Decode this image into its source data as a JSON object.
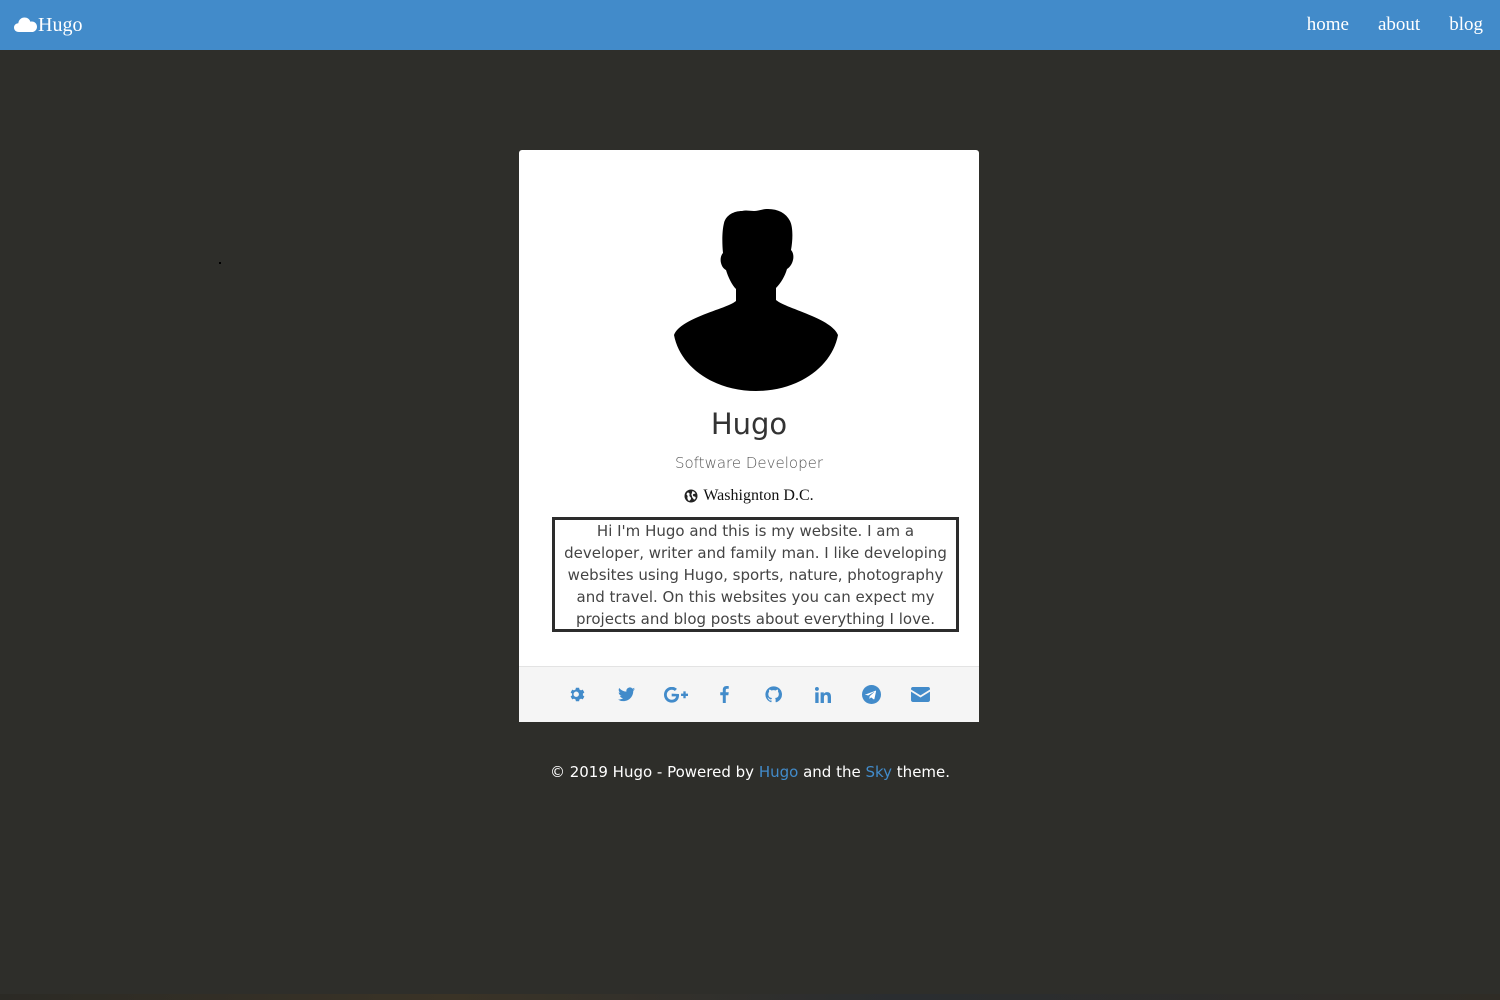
{
  "nav": {
    "brand": "Hugo",
    "links": [
      {
        "label": "home"
      },
      {
        "label": "about"
      },
      {
        "label": "blog"
      }
    ]
  },
  "profile": {
    "name": "Hugo",
    "role": "Software Developer",
    "location": "Washignton D.C.",
    "bio": "Hi I'm Hugo and this is my website. I am a developer, writer and family man. I like developing websites using Hugo, sports, nature, photography and travel. On this websites you can expect my projects and blog posts about everything I love. Enjoy!"
  },
  "social": [
    {
      "icon": "gear-icon"
    },
    {
      "icon": "twitter-icon"
    },
    {
      "icon": "google-plus-icon"
    },
    {
      "icon": "facebook-icon"
    },
    {
      "icon": "github-icon"
    },
    {
      "icon": "linkedin-icon"
    },
    {
      "icon": "telegram-icon"
    },
    {
      "icon": "email-icon"
    }
  ],
  "footer": {
    "prefix": "© 2019 Hugo - Powered by ",
    "hugo_link": "Hugo",
    "middle": " and the ",
    "sky_link": "Sky",
    "suffix": " theme."
  },
  "colors": {
    "navbar": "#428bca",
    "background": "#2e2e2a",
    "accent": "#428bca",
    "card": "#ffffff",
    "card_footer": "#f5f5f5"
  }
}
